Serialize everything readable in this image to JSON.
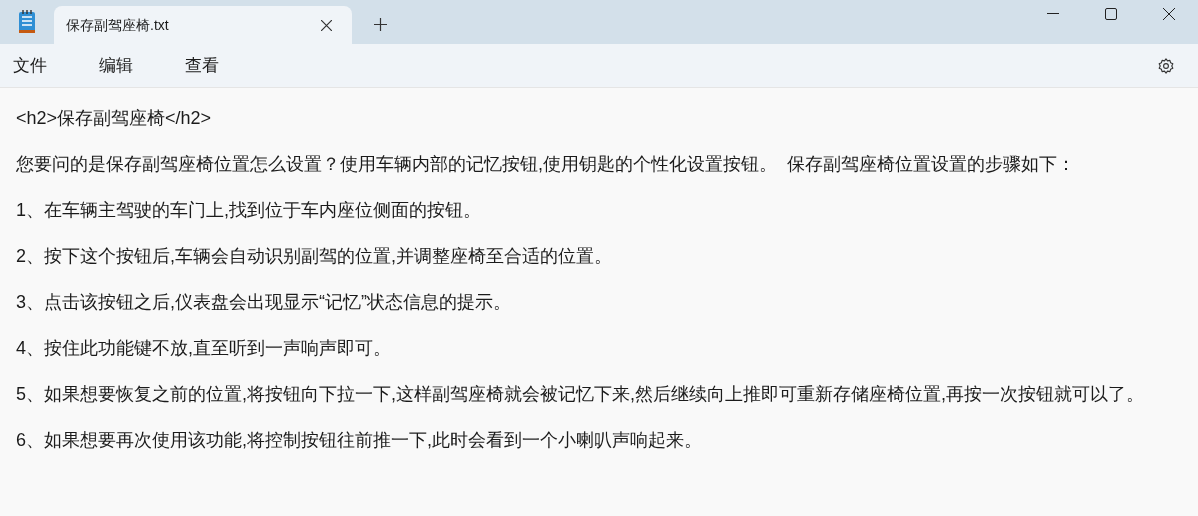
{
  "tabs": [
    {
      "label": "保存副驾座椅.txt",
      "selected": true
    }
  ],
  "menu": [
    "文件",
    "编辑",
    "查看"
  ],
  "lines": [
    "<h2>保存副驾座椅</h2>",
    "您要问的是保存副驾座椅位置怎么设置？使用车辆内部的记忆按钮,使用钥匙的个性化设置按钮。  保存副驾座椅位置设置的步骤如下：",
    "1、在车辆主驾驶的车门上,找到位于车内座位侧面的按钮。",
    "2、按下这个按钮后,车辆会自动识别副驾的位置,并调整座椅至合适的位置。",
    "3、点击该按钮之后,仪表盘会出现显示“记忆”状态信息的提示。",
    "4、按住此功能键不放,直至听到一声响声即可。",
    "5、如果想要恢复之前的位置,将按钮向下拉一下,这样副驾座椅就会被记忆下来,然后继续向上推即可重新存储座椅位置,再按一次按钮就可以了。",
    "6、如果想要再次使用该功能,将控制按钮往前推一下,此时会看到一个小喇叭声响起来。"
  ]
}
